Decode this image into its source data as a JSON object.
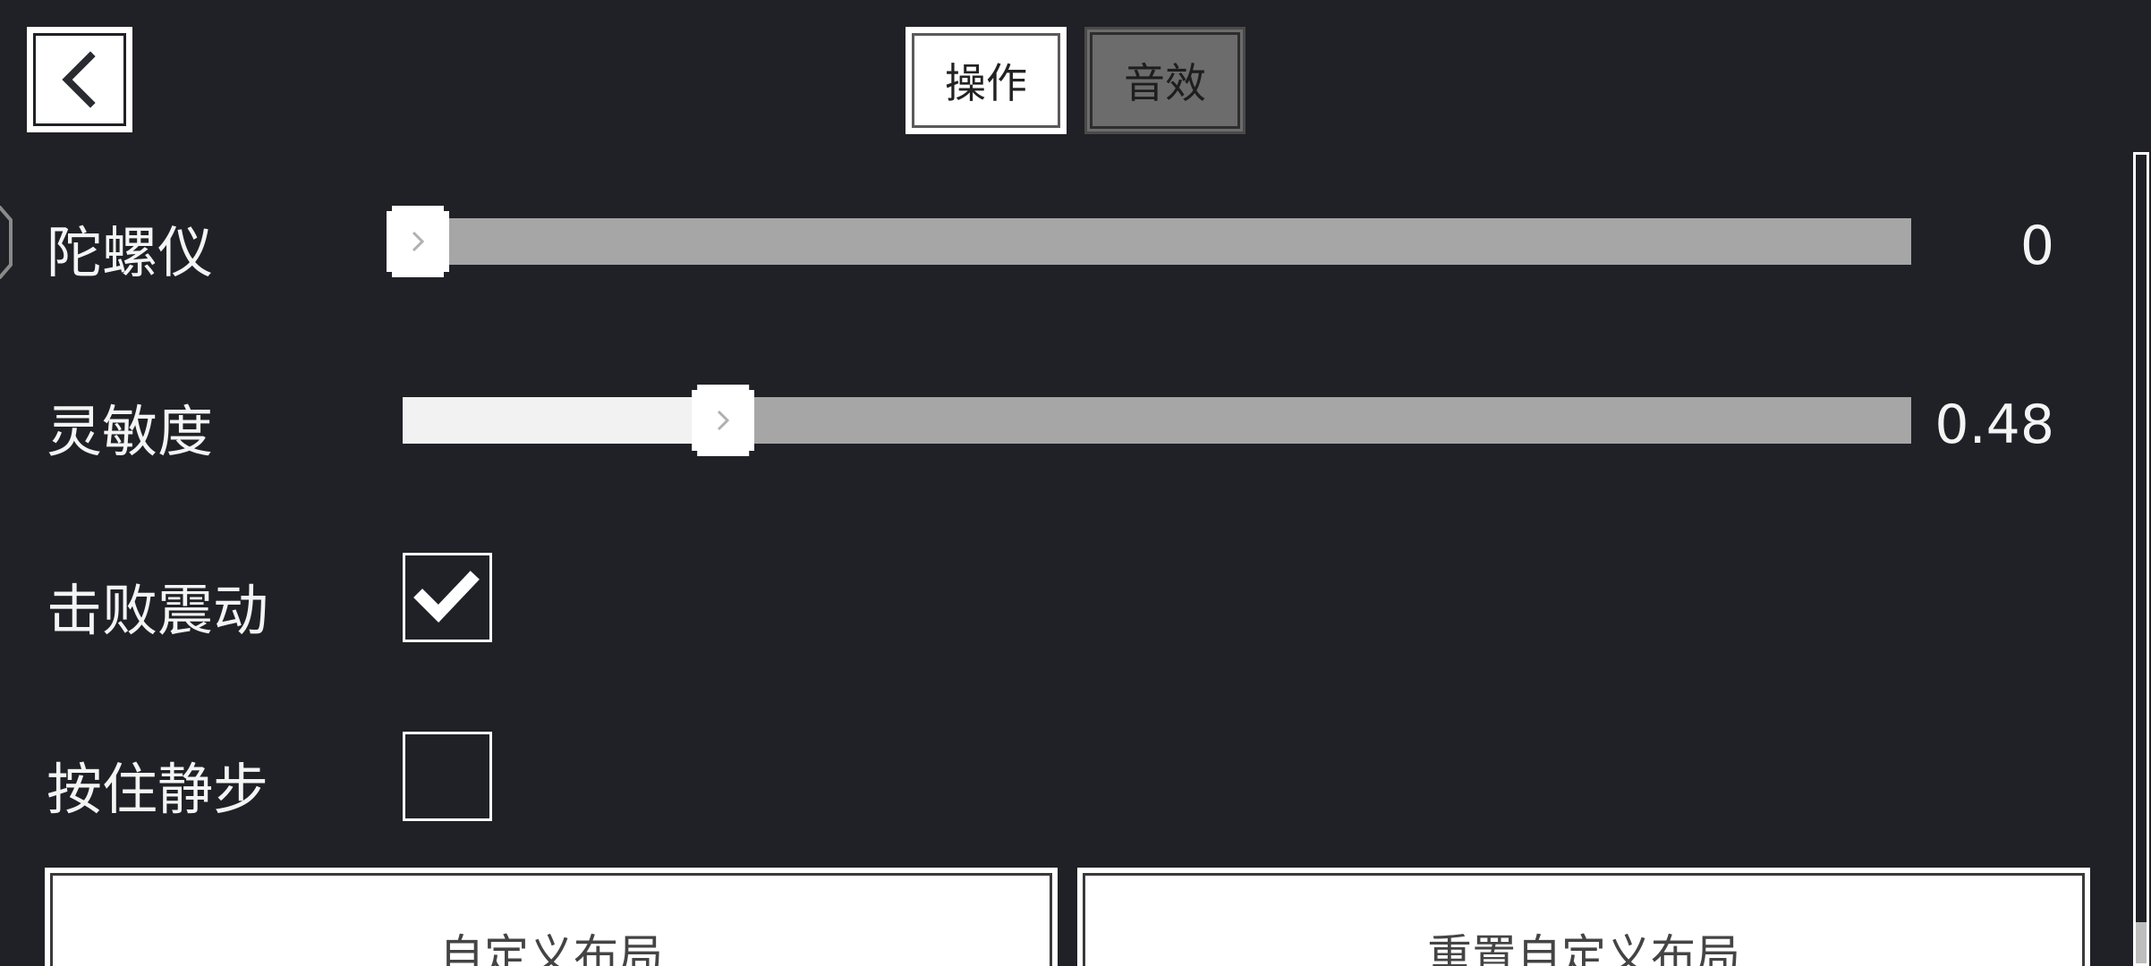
{
  "header": {
    "back_icon": "chevron-left-icon",
    "tabs": [
      {
        "label": "操作",
        "active": true
      },
      {
        "label": "音效",
        "active": false
      }
    ]
  },
  "settings": {
    "gyroscope": {
      "label": "陀螺仪",
      "value": 0,
      "value_text": "0"
    },
    "sensitivity": {
      "label": "灵敏度",
      "value": 0.48,
      "value_text": "0.48",
      "fill_fraction": 0.2
    },
    "defeat_vibration": {
      "label": "击败震动",
      "checked": true
    },
    "hold_sneak": {
      "label": "按住静步",
      "checked": false
    }
  },
  "footer": {
    "custom_layout_label": "自定义布局",
    "reset_layout_label": "重置自定义布局"
  },
  "colors": {
    "background": "#202126",
    "track": "#a6a6a6",
    "fill": "#f2f2f2",
    "text": "#f4f4f4"
  }
}
